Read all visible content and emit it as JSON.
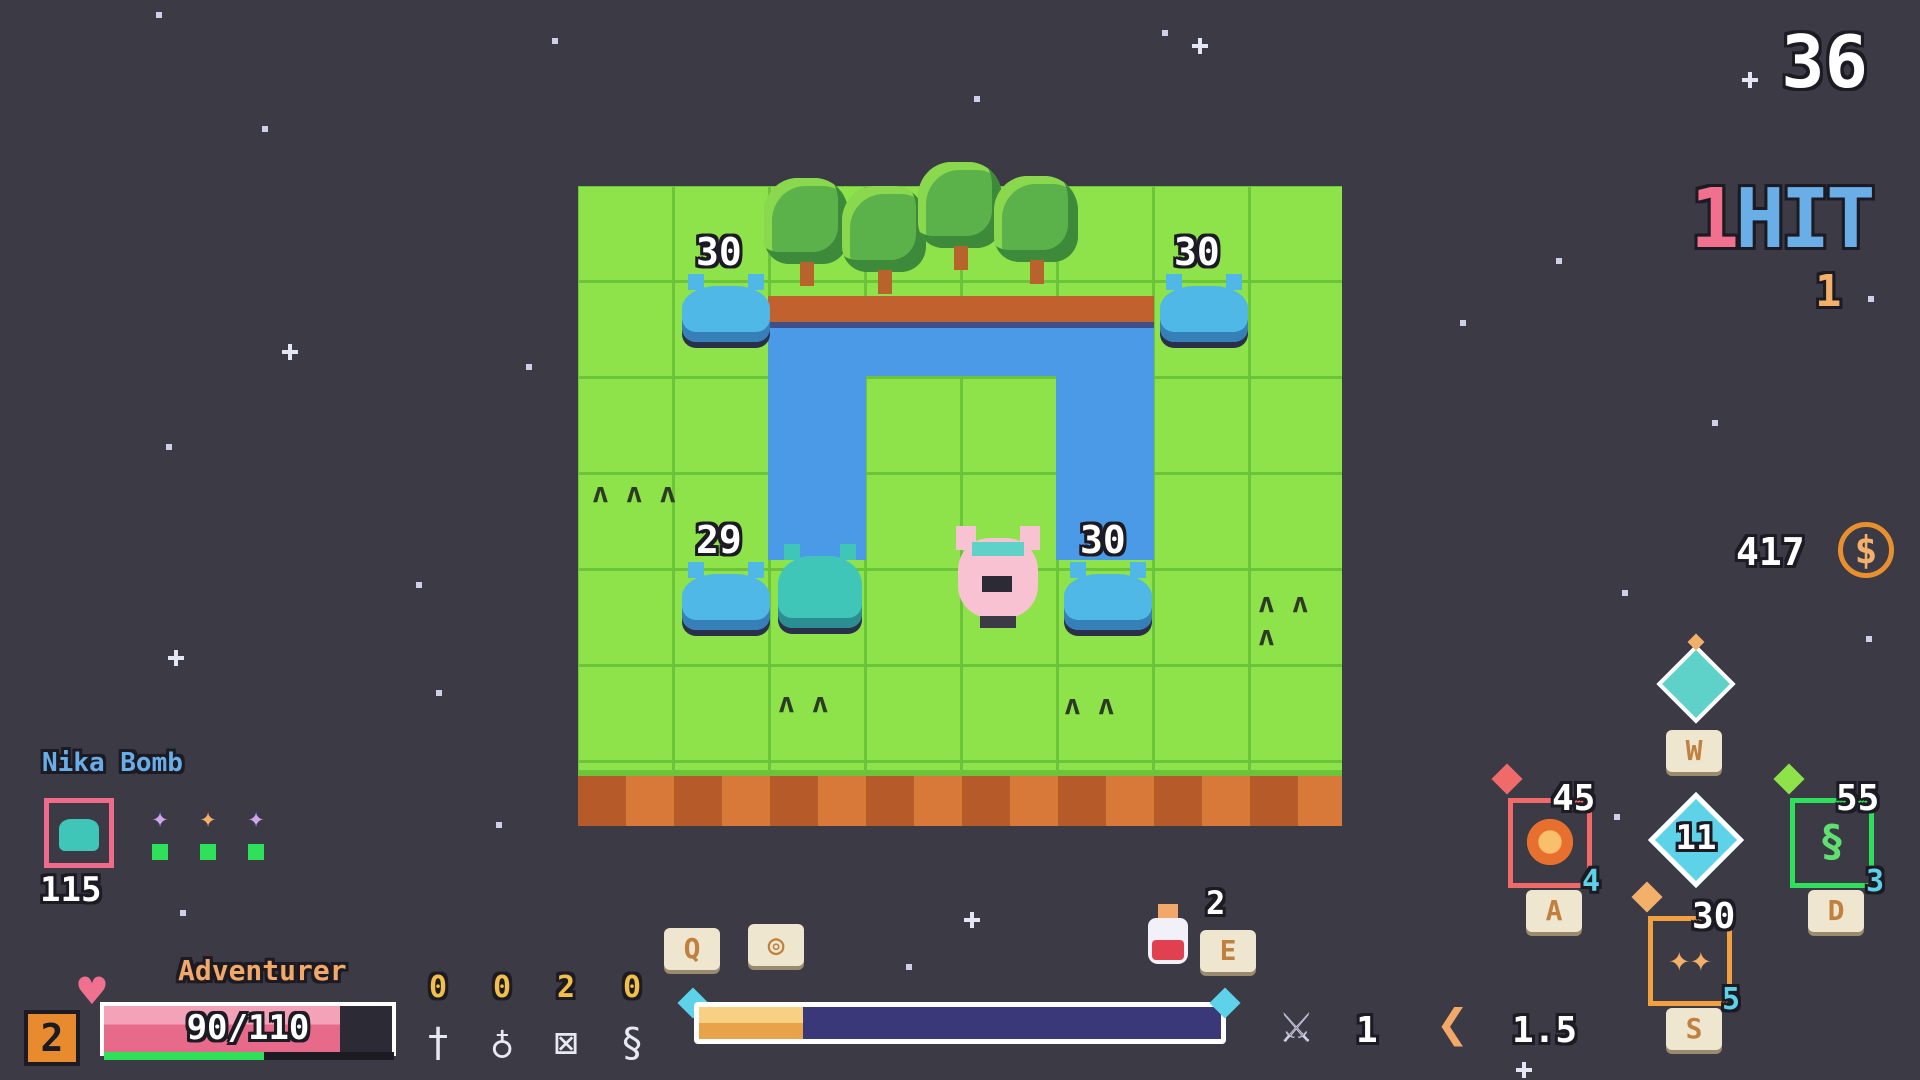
{
  "hud": {
    "timer": "36",
    "combo": {
      "count": "1",
      "word": "HIT",
      "sub": "1"
    },
    "coins": "417",
    "coin_icon": "$"
  },
  "enemies": [
    {
      "hp": "30"
    },
    {
      "hp": "30"
    },
    {
      "hp": "29"
    },
    {
      "hp": "30"
    }
  ],
  "item": {
    "name": "Nika Bomb",
    "count": "115"
  },
  "player": {
    "level": "2",
    "class": "Adventurer",
    "hp_text": "90/110",
    "hp_fraction": 0.818,
    "xp_fraction": 0.55
  },
  "stats": [
    {
      "value": "0",
      "icon": "dagger-icon",
      "glyph": "†",
      "color": "#f2c04a"
    },
    {
      "value": "0",
      "icon": "shield-icon",
      "glyph": "♁",
      "color": "#f2c04a"
    },
    {
      "value": "2",
      "icon": "ward-icon",
      "glyph": "⊠",
      "color": "#f2c04a"
    },
    {
      "value": "0",
      "icon": "chain-icon",
      "glyph": "§",
      "color": "#f2c04a"
    }
  ],
  "keys": {
    "q": "Q",
    "eye": "◎",
    "e": "E",
    "w": "W",
    "a": "A",
    "s": "S",
    "d": "D"
  },
  "skill_charge": 0.2,
  "potion": {
    "count": "2"
  },
  "attack": {
    "value": "1"
  },
  "speed": {
    "value": "1.5"
  },
  "abilities": {
    "a": {
      "cost": "45",
      "level": "4"
    },
    "s": {
      "cost": "30",
      "level": "5"
    },
    "d": {
      "cost": "55",
      "level": "3"
    },
    "center": "11"
  }
}
